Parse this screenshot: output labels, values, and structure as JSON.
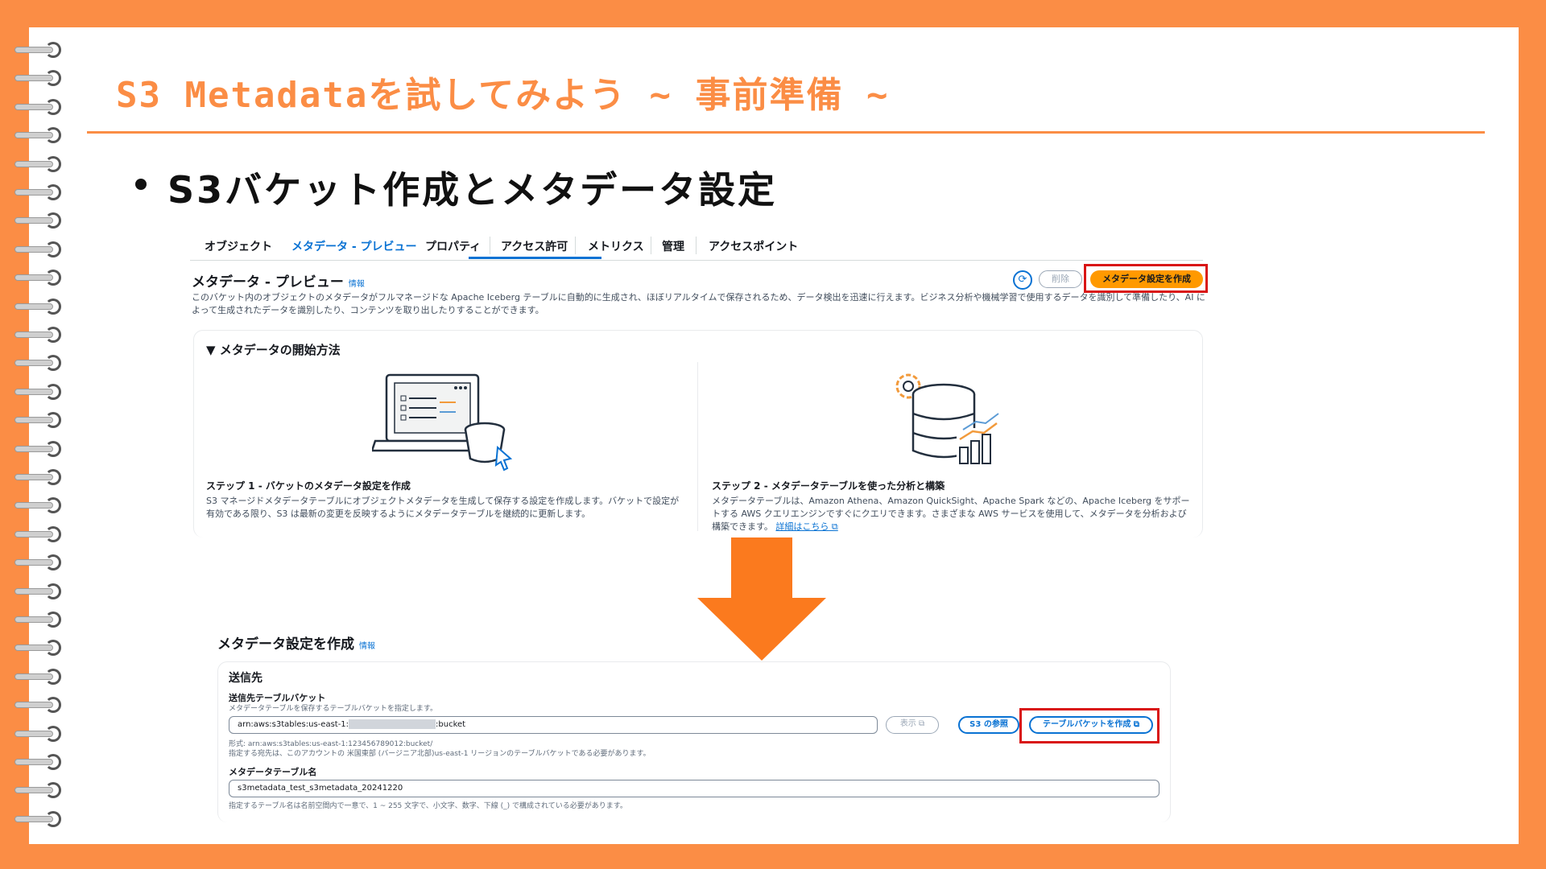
{
  "slide": {
    "title": "S3 Metadataを試してみよう ~ 事前準備 ~",
    "bullet": "S3バケット作成とメタデータ設定"
  },
  "tabs": [
    "オブジェクト",
    "メタデータ - プレビュー",
    "プロパティ",
    "アクセス許可",
    "メトリクス",
    "管理",
    "アクセスポイント"
  ],
  "active_tab": "メタデータ - プレビュー",
  "metadata_panel": {
    "title": "メタデータ - プレビュー",
    "info": "情報",
    "description": "このバケット内のオブジェクトのメタデータがフルマネージドな Apache Iceberg テーブルに自動的に生成され、ほぼリアルタイムで保存されるため、データ検出を迅速に行えます。ビジネス分析や機械学習で使用するデータを識別して準備したり、AI によって生成されたデータを識別したり、コンテンツを取り出したりすることができます。",
    "delete_label": "削除",
    "create_label": "メタデータ設定を作成",
    "refresh_icon": "refresh-icon"
  },
  "getting_started": {
    "title": "▼ メタデータの開始方法",
    "step1_title": "ステップ 1 - バケットのメタデータ設定を作成",
    "step1_desc": "S3 マネージドメタデータテーブルにオブジェクトメタデータを生成して保存する設定を作成します。バケットで設定が有効である限り、S3 は最新の変更を反映するようにメタデータテーブルを継続的に更新します。",
    "step2_title": "ステップ 2 - メタデータテーブルを使った分析と構築",
    "step2_desc": "メタデータテーブルは、Amazon Athena、Amazon QuickSight、Apache Spark などの、Apache Iceberg をサポートする AWS クエリエンジンですぐにクエリできます。さまざまな AWS サービスを使用して、メタデータを分析および構築できます。",
    "step2_link": "詳細はこちら"
  },
  "create_form": {
    "title": "メタデータ設定を作成",
    "info": "情報",
    "section": "送信先",
    "bucket_label": "送信先テーブルバケット",
    "bucket_hint": "メタデータテーブルを保存するテーブルバケットを指定します。",
    "bucket_value_prefix": "arn:aws:s3tables:us-east-1:",
    "bucket_value_suffix": ":bucket",
    "view_label": "表示",
    "browse_label": "S3 の参照",
    "create_bucket_label": "テーブルバケットを作成",
    "format_hint": "形式: arn:aws:s3tables:us-east-1:123456789012:bucket/",
    "region_hint": "指定する宛先は、このアカウントの 米国東部 (バージニア北部)us-east-1 リージョンのテーブルバケットである必要があります。",
    "table_label": "メタデータテーブル名",
    "table_value": "s3metadata_test_s3metadata_20241220",
    "table_hint": "指定するテーブル名は名前空間内で一意で、1 ~ 255 文字で、小文字、数字、下線 (_) で構成されている必要があります。"
  },
  "colors": {
    "background": "#fb8d45",
    "accent": "#fb8d45",
    "arrow": "#fb7a1e",
    "aws_blue": "#0972d3",
    "aws_orange": "#ff9900",
    "highlight_red": "#d91515"
  }
}
